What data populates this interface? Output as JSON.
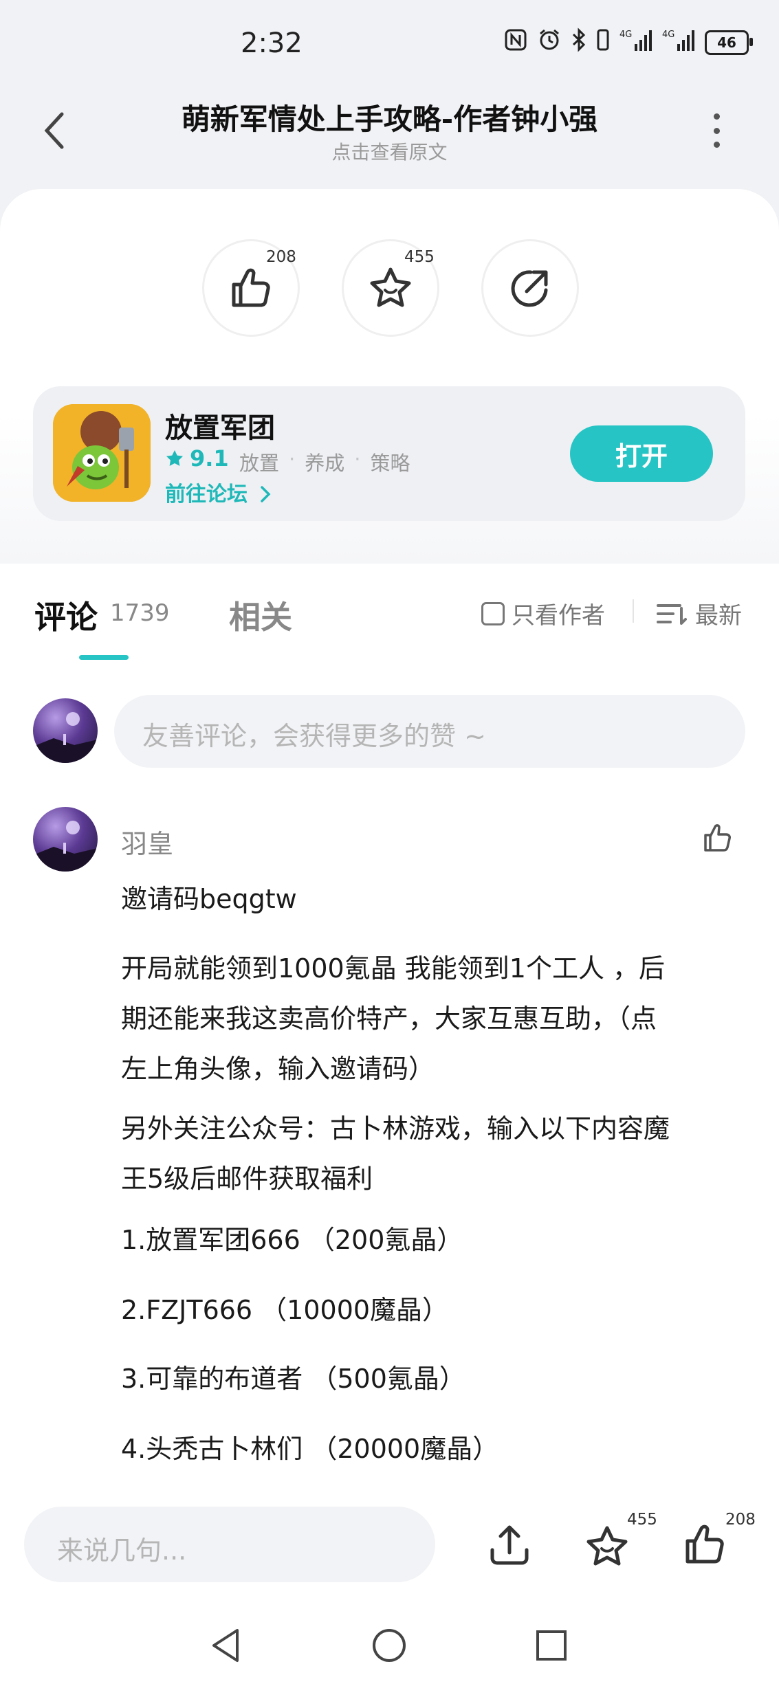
{
  "status_bar": {
    "time": "2:32",
    "battery": "46",
    "signal_labels": [
      "4G",
      "4G"
    ]
  },
  "header": {
    "title": "萌新军情处上手攻略-作者钟小强",
    "subtitle": "点击查看原文"
  },
  "actions": {
    "like_count": "208",
    "favorite_count": "455"
  },
  "app": {
    "name": "放置军团",
    "rating": "9.1",
    "tags": [
      "放置",
      "养成",
      "策略"
    ],
    "forum_link": "前往论坛",
    "open_button": "打开"
  },
  "comments_section": {
    "tab_comments": "评论",
    "comment_count": "1739",
    "tab_related": "相关",
    "author_only": "只看作者",
    "sort_latest": "最新",
    "input_placeholder": "友善评论，会获得更多的赞 ~"
  },
  "comment": {
    "user_name": "羽皇",
    "lines": [
      "邀请码beqgtw",
      "开局就能领到1000氪晶  我能领到1个工人  ，后",
      "期还能来我这卖高价特产，大家互惠互助，（点",
      "左上角头像，输入邀请码）",
      "另外关注公众号：古卜林游戏，输入以下内容魔",
      "王5级后邮件获取福利",
      "1.放置军团666 （200氪晶）",
      "2.FZJT666 （10000魔晶）",
      "3.可靠的布道者 （500氪晶）",
      "4.头秃古卜林们 （20000魔晶）"
    ]
  },
  "bottom_bar": {
    "input_placeholder": "来说几句...",
    "favorite_count": "455",
    "like_count": "208"
  },
  "colors": {
    "accent": "#26c4c4",
    "background": "#f1f2f5"
  }
}
